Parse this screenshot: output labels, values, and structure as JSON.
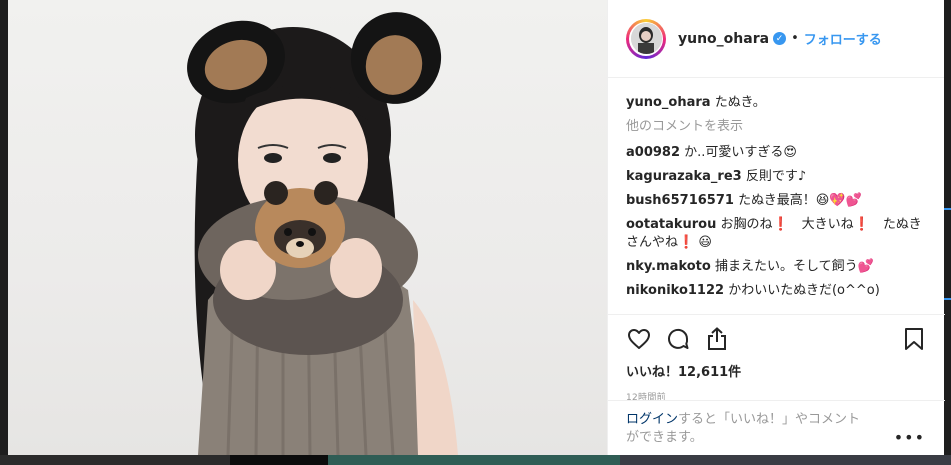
{
  "post": {
    "username": "yuno_ohara",
    "verified_icon": "verified-badge-icon",
    "dot": "•",
    "follow_label": "フォローする",
    "caption_user": "yuno_ohara",
    "caption_text": "たぬき。",
    "more_comments": "他のコメントを表示",
    "comments": [
      {
        "user": "a00982",
        "text": "か..可愛いすぎる😍"
      },
      {
        "user": "kagurazaka_re3",
        "text": "反則です♪"
      },
      {
        "user": "bush65716571",
        "text": "たぬき最高！😆💖💕"
      },
      {
        "user": "ootatakurou",
        "text": "お胸のね❗　大きいね❗　たぬきさんやね❗ 😃"
      },
      {
        "user": "nky.makoto",
        "text": "捕まえたい。そして飼う💕"
      },
      {
        "user": "nikoniko1122",
        "text": "かわいいたぬきだ(o^^o)"
      }
    ],
    "likes": "いいね！12,611件",
    "timestamp": "12時間前",
    "login_link": "ログイン",
    "login_text_1": "すると「いいね！」やコメント",
    "login_text_2": "ができます。",
    "more_options": "•••"
  },
  "icons": {
    "like": "heart-icon",
    "comment": "comment-icon",
    "share": "share-icon",
    "save": "bookmark-icon"
  },
  "colors": {
    "link_blue": "#3897f0",
    "login_link": "#003569",
    "muted_text": "#999999",
    "text": "#262626"
  }
}
